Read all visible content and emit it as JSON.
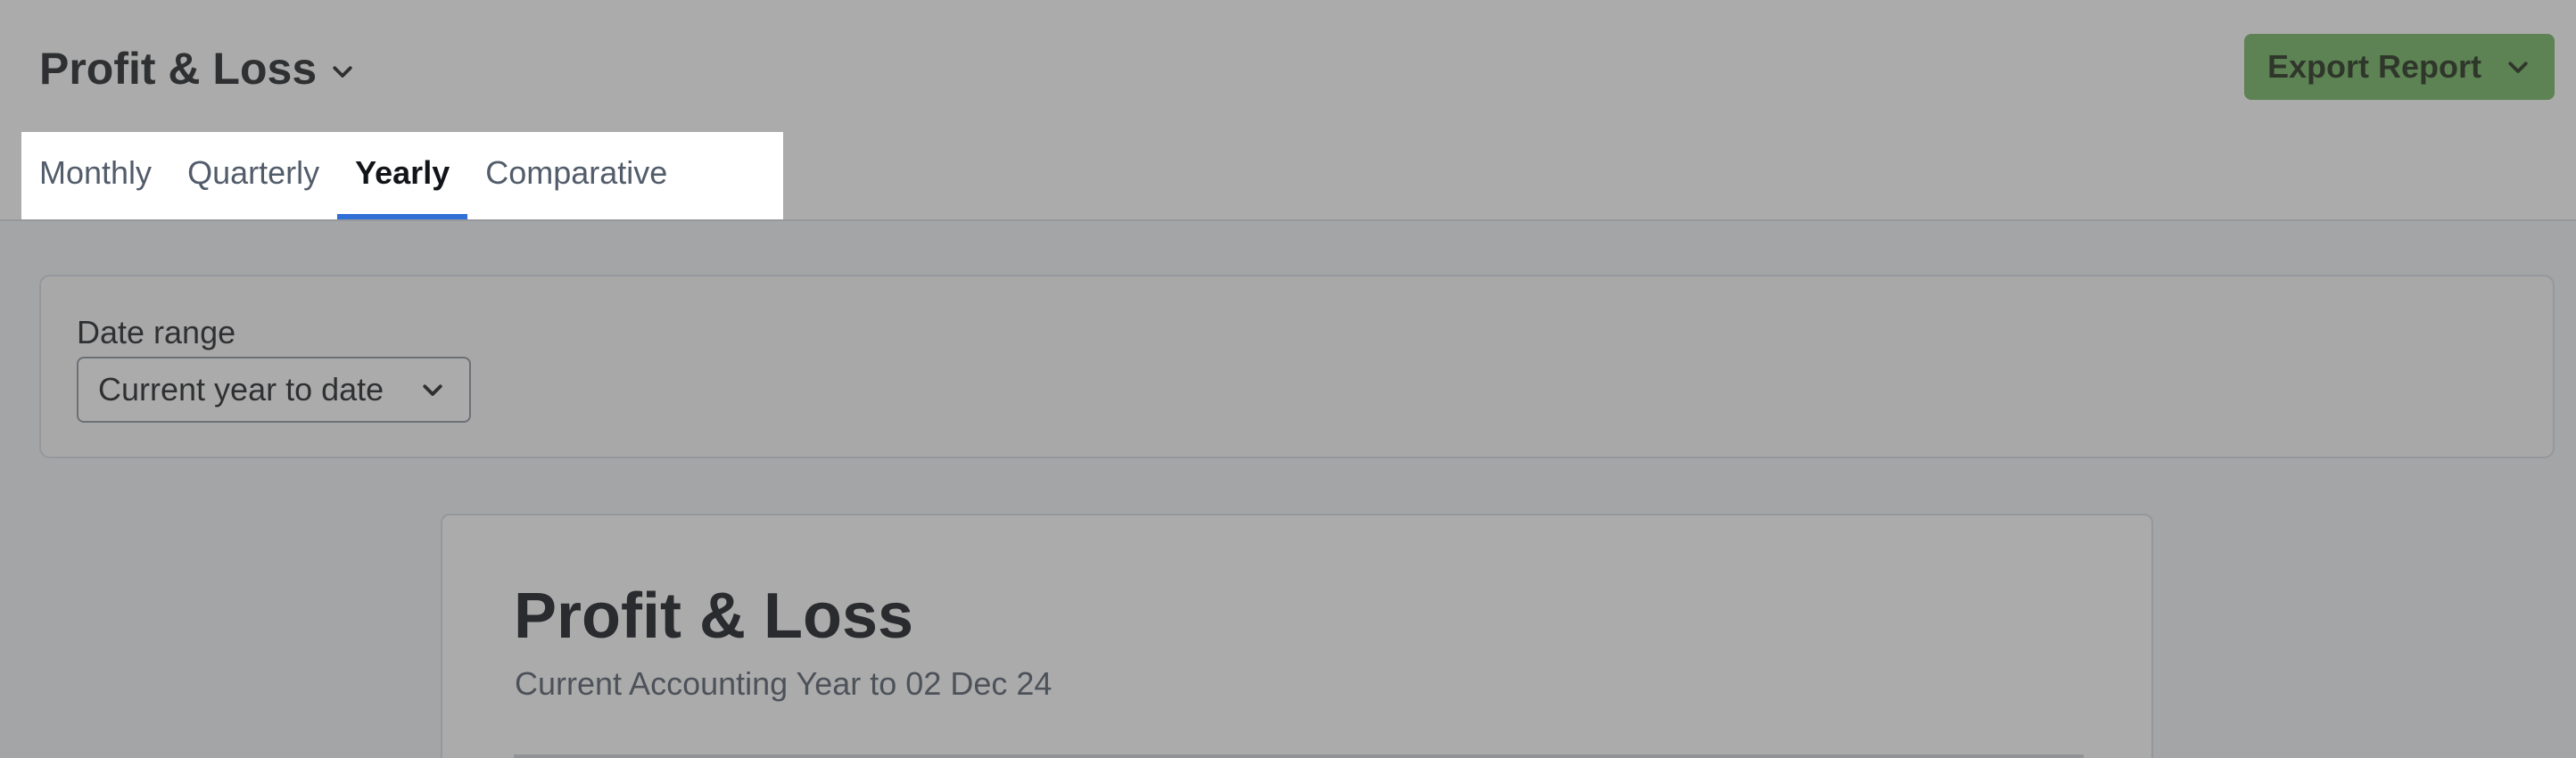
{
  "header": {
    "title": "Profit & Loss",
    "export_label": "Export Report"
  },
  "tabs": [
    {
      "label": "Monthly",
      "active": false
    },
    {
      "label": "Quarterly",
      "active": false
    },
    {
      "label": "Yearly",
      "active": true
    },
    {
      "label": "Comparative",
      "active": false
    }
  ],
  "filters": {
    "date_range_label": "Date range",
    "date_range_value": "Current year to date"
  },
  "report": {
    "title": "Profit & Loss",
    "subtitle": "Current Accounting Year to 02 Dec 24"
  },
  "colors": {
    "accent": "#2f6fd6",
    "export_button": "#6fb45d",
    "overlay": "rgba(72,72,72,0.46)"
  },
  "icons": {
    "title_dropdown": "chevron-down-icon",
    "export_dropdown": "chevron-down-icon",
    "select_dropdown": "chevron-down-icon"
  }
}
